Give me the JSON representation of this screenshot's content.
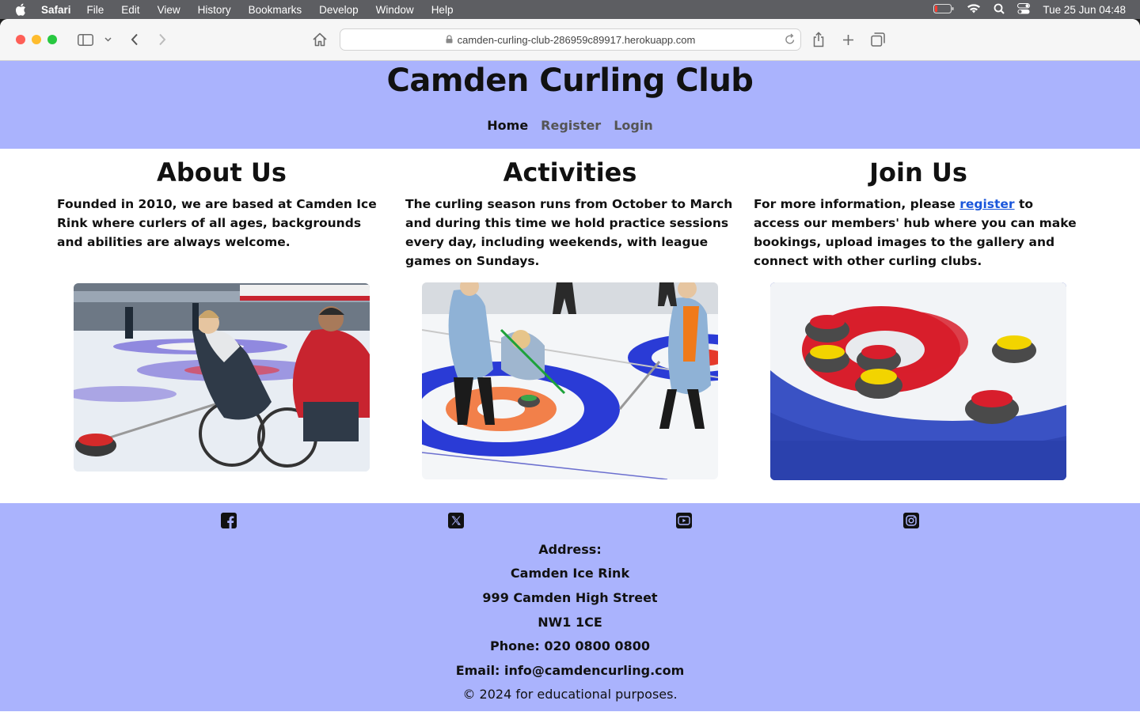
{
  "menubar": {
    "app": "Safari",
    "items": [
      "File",
      "Edit",
      "View",
      "History",
      "Bookmarks",
      "Develop",
      "Window",
      "Help"
    ],
    "datetime": "Tue 25 Jun  04:48"
  },
  "browser": {
    "url": "camden-curling-club-286959c89917.herokuapp.com"
  },
  "site": {
    "title": "Camden Curling Club",
    "nav": [
      "Home",
      "Register",
      "Login"
    ]
  },
  "sections": [
    {
      "heading": "About Us",
      "text": "Founded in 2010, we are based at Camden Ice Rink where curlers of all ages, backgrounds and abilities are always welcome."
    },
    {
      "heading": "Activities",
      "text": "The curling season runs from October to March and during this time we hold practice sessions every day, including weekends, with league games on Sundays."
    },
    {
      "heading": "Join Us",
      "text_before": "For more information, please ",
      "link": "register",
      "text_after": " to access our members' hub where you can make bookings, upload images to the gallery and connect with other curling clubs."
    }
  ],
  "footer": {
    "social": [
      "facebook-icon",
      "x-icon",
      "youtube-icon",
      "instagram-icon"
    ],
    "address_label": "Address:",
    "address_lines": [
      "Camden Ice Rink",
      "999 Camden High Street",
      "NW1 1CE"
    ],
    "phone_label": "Phone:",
    "phone": "020 0800 0800",
    "email_label": "Email:",
    "email": "info@camdencurling.com",
    "copyright": "© 2024 for educational purposes."
  },
  "colors": {
    "brand": "#aab3fd",
    "link": "#1a56db",
    "stone_red": "#d81e2c",
    "stone_yellow": "#f2d400"
  }
}
